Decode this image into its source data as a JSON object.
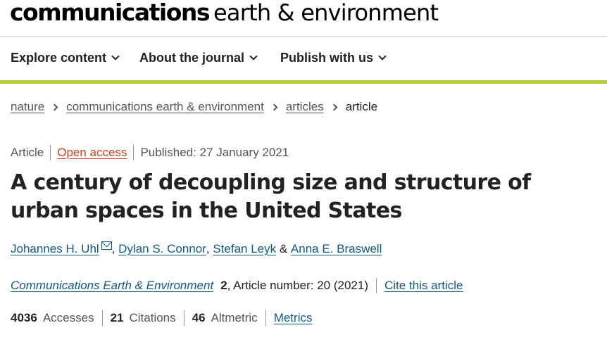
{
  "header": {
    "brand_bold": "communications",
    "brand_light": "earth & environment"
  },
  "nav": {
    "items": [
      {
        "label": "Explore content",
        "icon": "chevron-down-icon"
      },
      {
        "label": "About the journal",
        "icon": "chevron-down-icon"
      },
      {
        "label": "Publish with us",
        "icon": "chevron-down-icon"
      }
    ],
    "accent_color": "#b3cd3c"
  },
  "breadcrumb": {
    "items": [
      "nature",
      "communications earth & environment",
      "articles"
    ],
    "current": "article"
  },
  "article": {
    "type": "Article",
    "access": "Open access",
    "published": "Published: 27 January 2021",
    "title": "A century of decoupling size and structure of urban spaces in the United States",
    "authors": [
      {
        "name": "Johannes H. Uhl",
        "has_email": true
      },
      {
        "name": "Dylan S. Connor"
      },
      {
        "name": "Stefan Leyk"
      },
      {
        "name": "Anna E. Braswell"
      }
    ],
    "author_separators": [
      ", ",
      ", ",
      " & "
    ],
    "journal": "Communications Earth & Environment",
    "volume": "2",
    "article_number": ", Article number: 20 (2021)",
    "cite_label": "Cite this article"
  },
  "metrics": {
    "accesses_value": "4036",
    "accesses_label": "Accesses",
    "citations_value": "21",
    "citations_label": "Citations",
    "altmetric_value": "46",
    "altmetric_label": "Altmetric",
    "metrics_link": "Metrics"
  },
  "colors": {
    "link": "#0e5a85",
    "open_access": "#c4441d",
    "text": "#222222",
    "muted": "#555555"
  }
}
